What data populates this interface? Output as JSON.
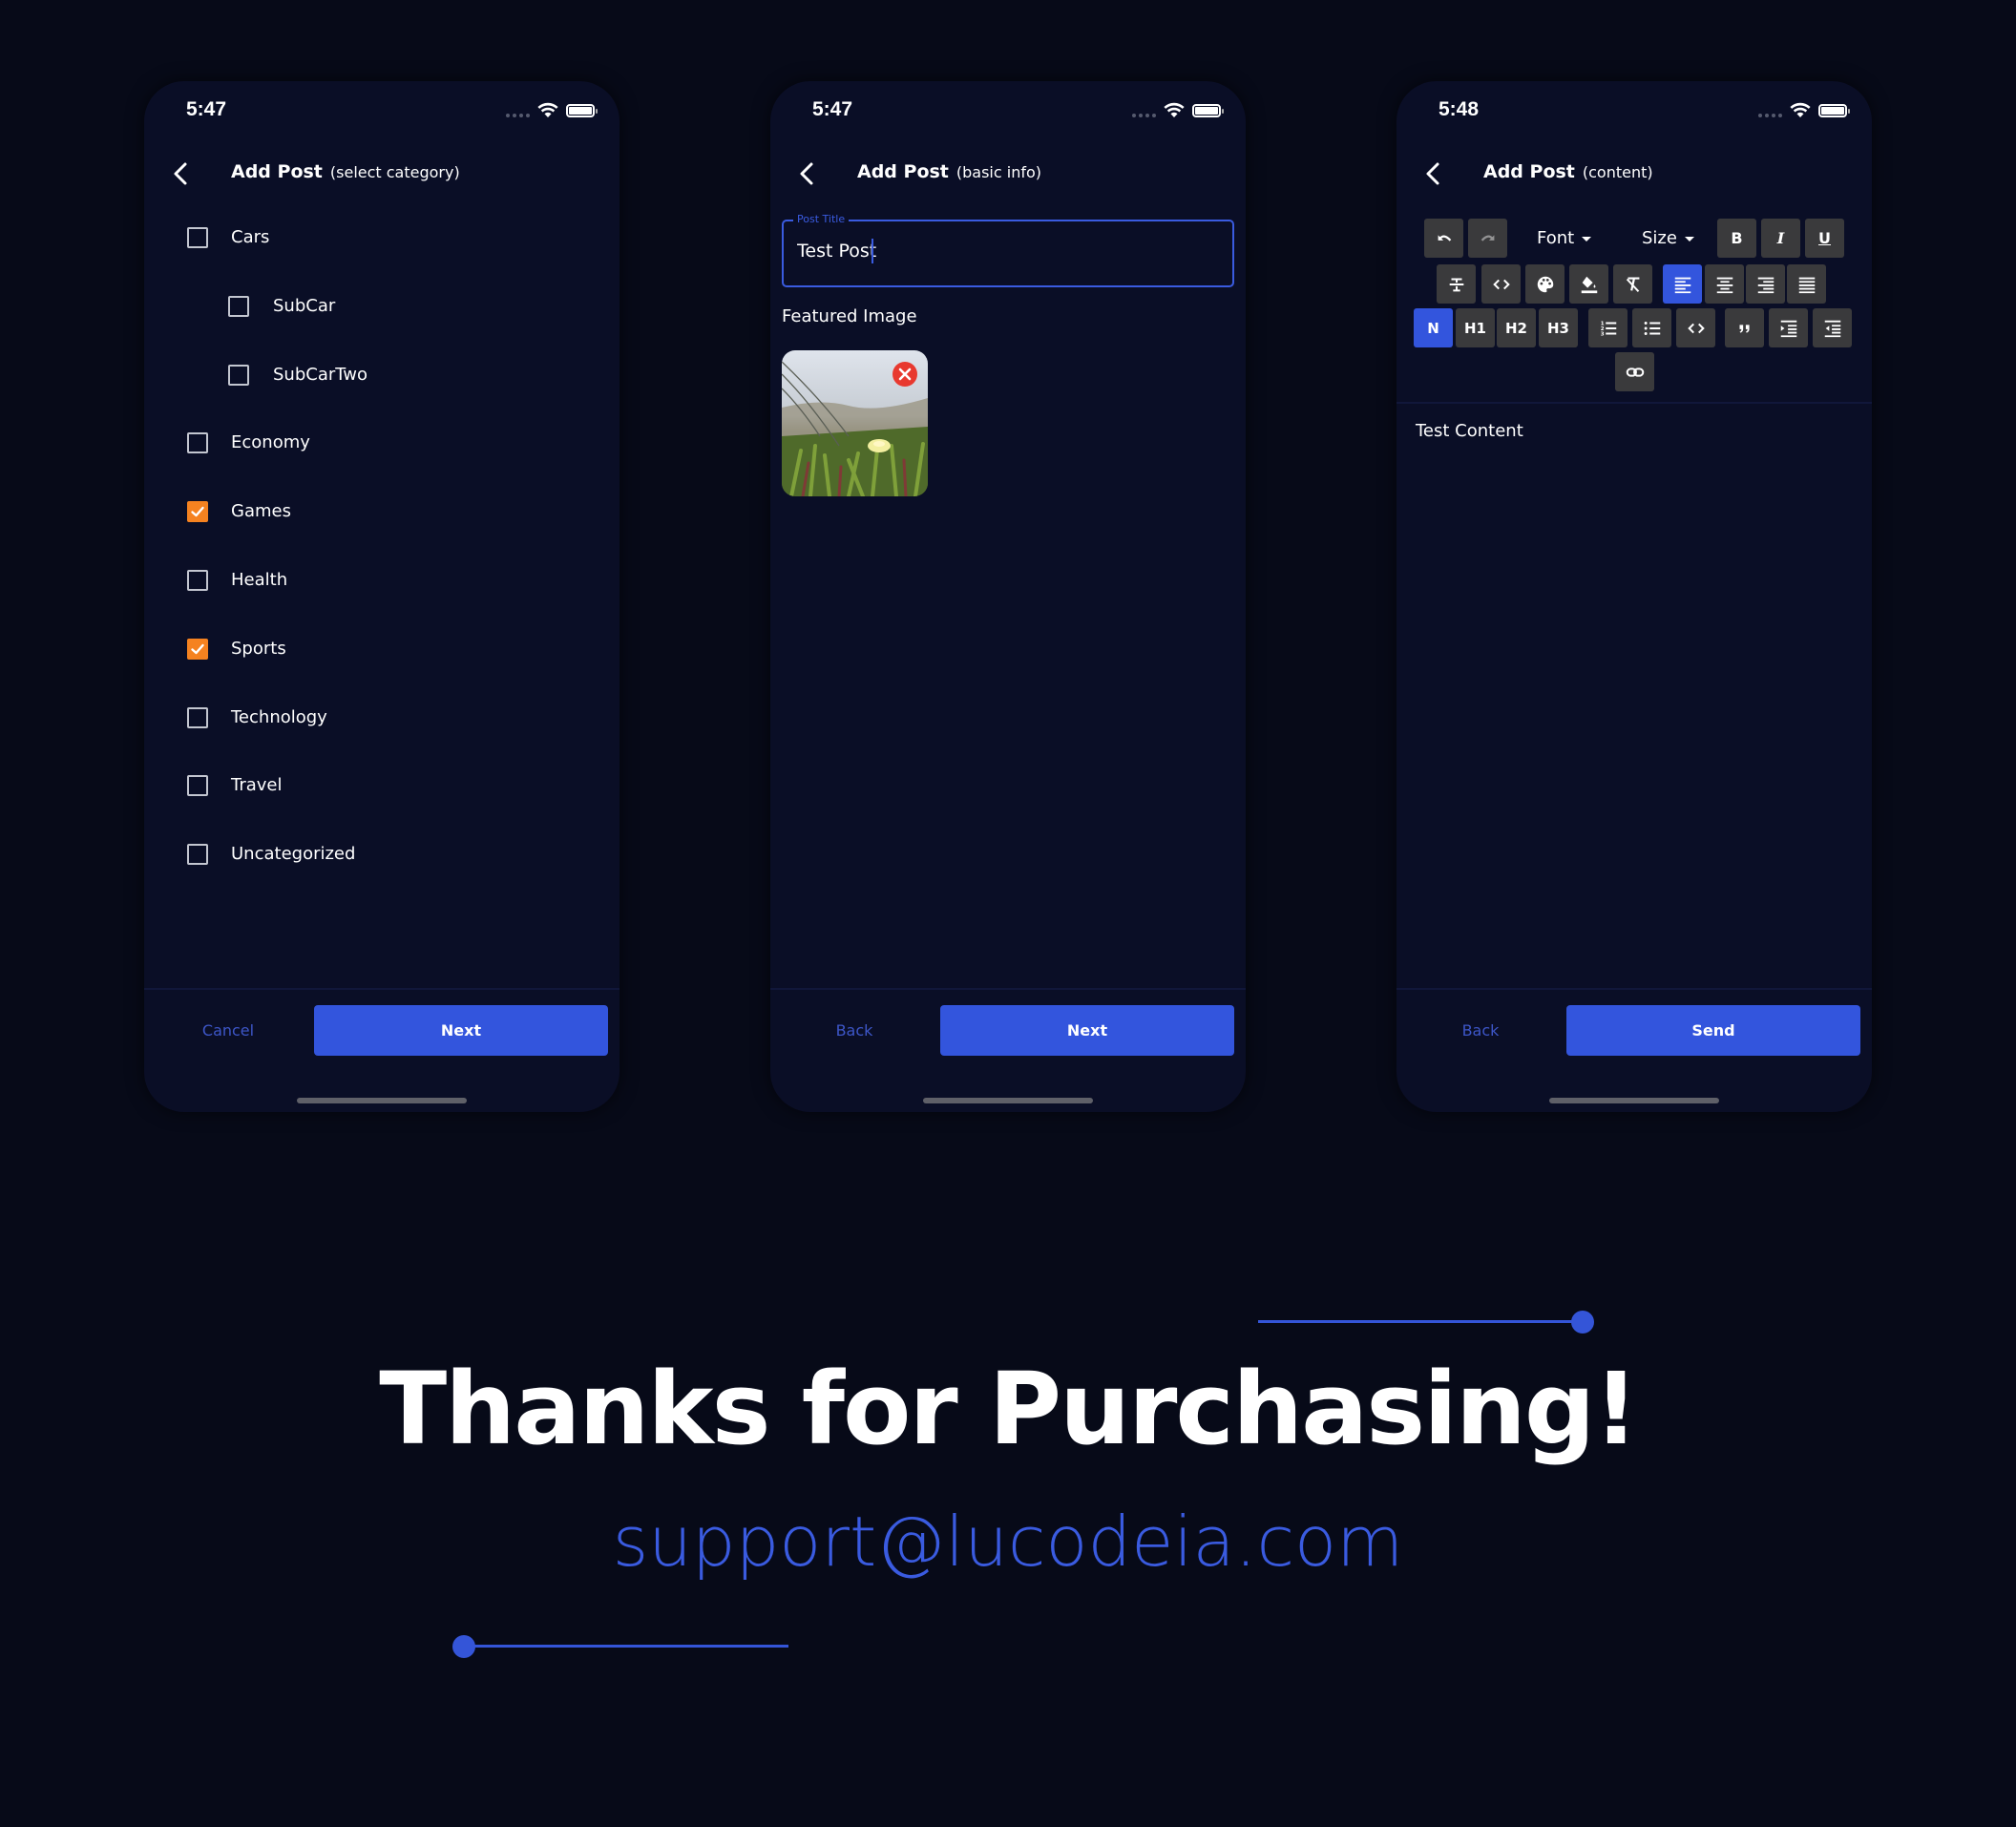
{
  "colors": {
    "background": "#070a18",
    "phone": "#0a0e26",
    "accent": "#3355dd",
    "checkbox_checked": "#f58220",
    "remove": "#e8392f"
  },
  "phones": [
    {
      "status": {
        "time": "5:47"
      },
      "header": {
        "title": "Add Post",
        "subtitle": "(select category)"
      },
      "categories": [
        {
          "label": "Cars",
          "checked": false,
          "level": 0
        },
        {
          "label": "SubCar",
          "checked": false,
          "level": 1
        },
        {
          "label": "SubCarTwo",
          "checked": false,
          "level": 1
        },
        {
          "label": "Economy",
          "checked": false,
          "level": 0
        },
        {
          "label": "Games",
          "checked": true,
          "level": 0
        },
        {
          "label": "Health",
          "checked": false,
          "level": 0
        },
        {
          "label": "Sports",
          "checked": true,
          "level": 0
        },
        {
          "label": "Technology",
          "checked": false,
          "level": 0
        },
        {
          "label": "Travel",
          "checked": false,
          "level": 0
        },
        {
          "label": "Uncategorized",
          "checked": false,
          "level": 0
        }
      ],
      "footer": {
        "secondary": "Cancel",
        "primary": "Next"
      }
    },
    {
      "status": {
        "time": "5:47"
      },
      "header": {
        "title": "Add Post",
        "subtitle": "(basic info)"
      },
      "post_title": {
        "label": "Post Title",
        "value": "Test Post"
      },
      "featured_image": {
        "label": "Featured Image",
        "icon": "remove-circle-icon"
      },
      "footer": {
        "secondary": "Back",
        "primary": "Next"
      }
    },
    {
      "status": {
        "time": "5:48"
      },
      "header": {
        "title": "Add Post",
        "subtitle": "(content)"
      },
      "toolbar": {
        "font_label": "Font",
        "size_label": "Size",
        "bold": "B",
        "italic": "I",
        "underline": "U",
        "normal": "N",
        "h1": "H1",
        "h2": "H2",
        "h3": "H3",
        "active_alignment": "left",
        "active_block": "normal"
      },
      "content": "Test Content",
      "footer": {
        "secondary": "Back",
        "primary": "Send"
      }
    }
  ],
  "bottom": {
    "title": "Thanks for Purchasing!",
    "email": "support@lucodeia.com"
  }
}
